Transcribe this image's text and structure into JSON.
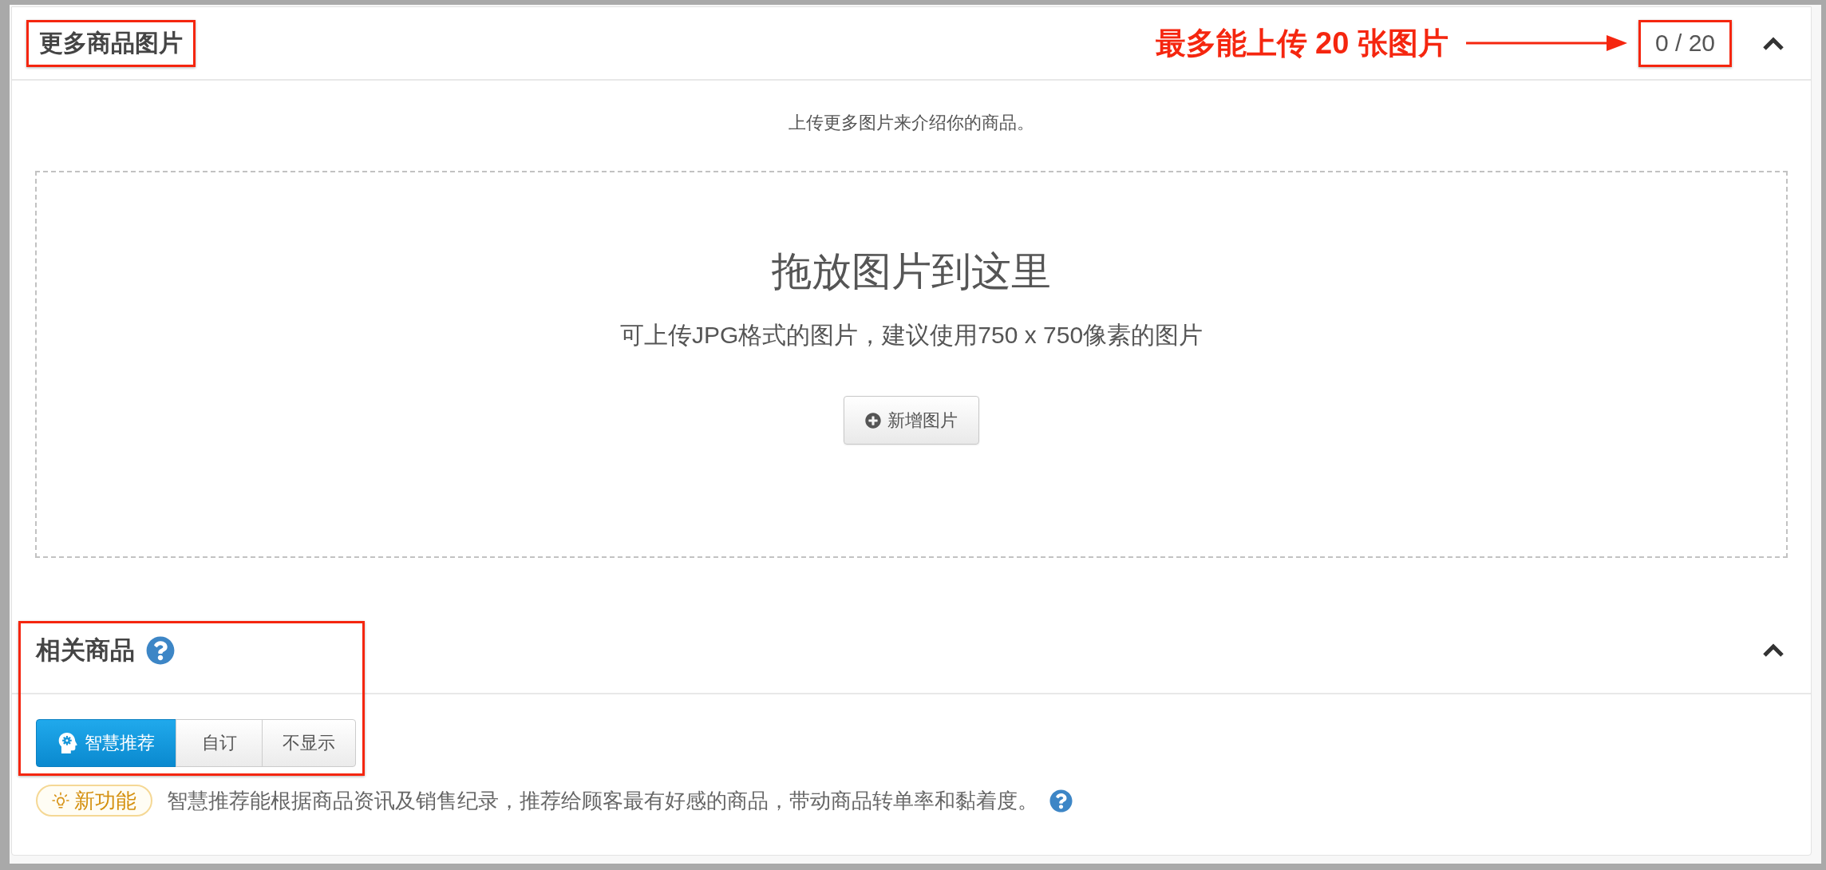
{
  "sections": [
    {
      "kind": "upload",
      "title": {
        "text": "更多商品图片",
        "highlighted": true
      },
      "annotation": "最多能上传 20 张图片",
      "counter": {
        "text": "0 / 20",
        "highlighted": true
      },
      "expanded": true,
      "intro": "上传更多图片来介绍你的商品。",
      "dropzone": {
        "heading": "拖放图片到这里",
        "hint": "可上传JPG格式的图片，建议使用750 x 750像素的图片",
        "button": "新增图片"
      }
    },
    {
      "kind": "related",
      "title": {
        "text": "相关商品"
      },
      "highlighted": true,
      "expanded": true,
      "options": [
        {
          "label": "智慧推荐",
          "kind": "smart",
          "selected": true
        },
        {
          "label": "自订",
          "kind": "plain",
          "selected": false
        },
        {
          "label": "不显示",
          "kind": "plain",
          "selected": false
        }
      ],
      "badge": "新功能",
      "description": "智慧推荐能根据商品资讯及销售纪录，推荐给顾客最有好感的商品，带动商品转单率和黏着度。"
    }
  ]
}
